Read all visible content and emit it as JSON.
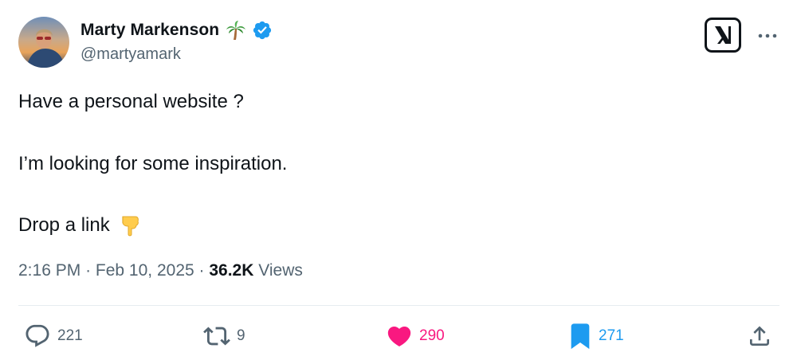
{
  "author": {
    "display_name": "Marty Markenson",
    "handle": "@martyamark",
    "name_emoji": "palm-tree",
    "verified": true
  },
  "tweet": {
    "lines": [
      "Have a personal website ?",
      "I’m looking for some inspiration.",
      "Drop a link"
    ],
    "trailing_emoji": "pointing-down-hand"
  },
  "meta": {
    "time": "2:16 PM",
    "separator": "·",
    "date": "Feb 10, 2025",
    "views_count": "36.2K",
    "views_label": "Views"
  },
  "actions": {
    "replies": "221",
    "reposts": "9",
    "likes": "290",
    "bookmarks": "271"
  },
  "colors": {
    "text": "#0f1419",
    "secondary": "#536471",
    "like_active": "#f91880",
    "bookmark_active": "#1d9bf0",
    "verified": "#1d9bf0"
  }
}
